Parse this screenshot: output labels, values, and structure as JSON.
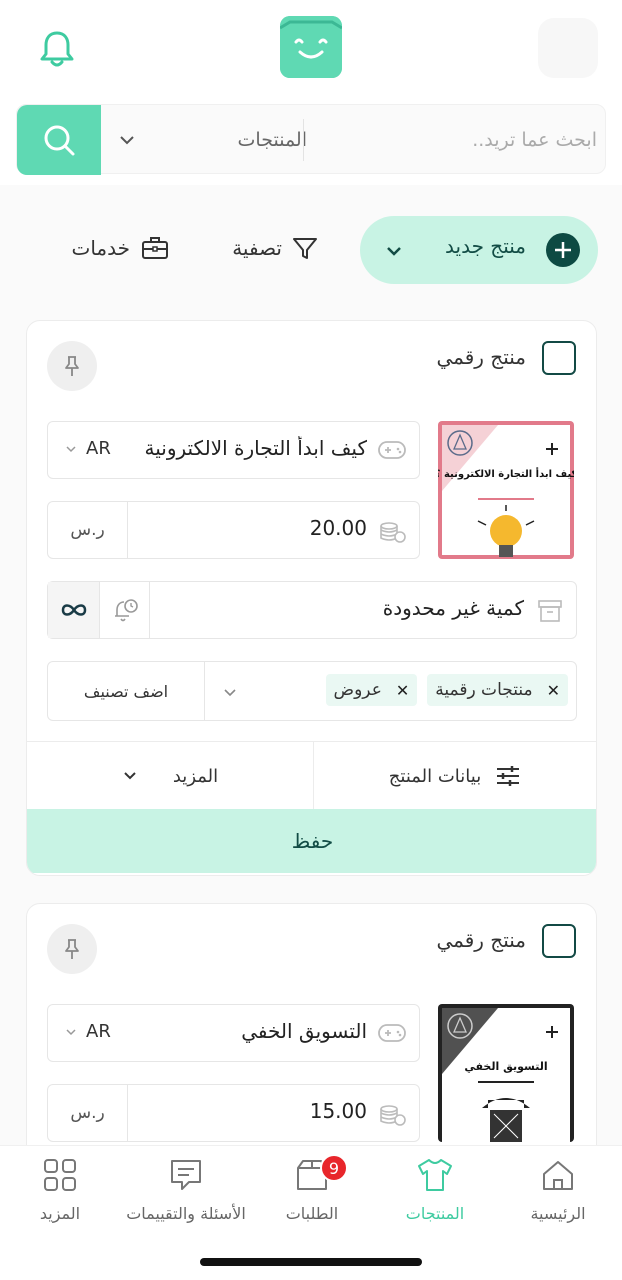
{
  "header": {
    "search_placeholder": "ابحث عما تريد..",
    "search_category": "المنتجات"
  },
  "toolbar": {
    "new_product": "منتج جديد",
    "filter": "تصفية",
    "services": "خدمات"
  },
  "products": [
    {
      "type_label": "منتج رقمي",
      "name": "كيف ابدأ التجارة الالكترونية",
      "lang": "AR",
      "price": "20.00",
      "currency": "ر.س",
      "quantity": "كمية غير محدودة",
      "thumb_title": "كيف ابدأ التجارة الالكترونية ؟",
      "tags": [
        {
          "label": "منتجات رقمية"
        },
        {
          "label": "عروض"
        }
      ],
      "add_category": "اضف تصنيف",
      "product_data": "بيانات المنتج",
      "more": "المزيد",
      "save": "حفظ"
    },
    {
      "type_label": "منتج رقمي",
      "name": "التسويق الخفي",
      "lang": "AR",
      "price": "15.00",
      "currency": "ر.س",
      "thumb_title": "التسويق الخفي"
    }
  ],
  "bottom_nav": {
    "home": "الرئيسية",
    "products": "المنتجات",
    "orders": "الطلبات",
    "orders_badge": "9",
    "questions": "الأسئلة والتقييمات",
    "more": "المزيد"
  },
  "colors": {
    "accent": "#5fd9b3",
    "accent_light": "#c8f3e4",
    "dark_green": "#124c45",
    "badge_red": "#e8262b"
  }
}
